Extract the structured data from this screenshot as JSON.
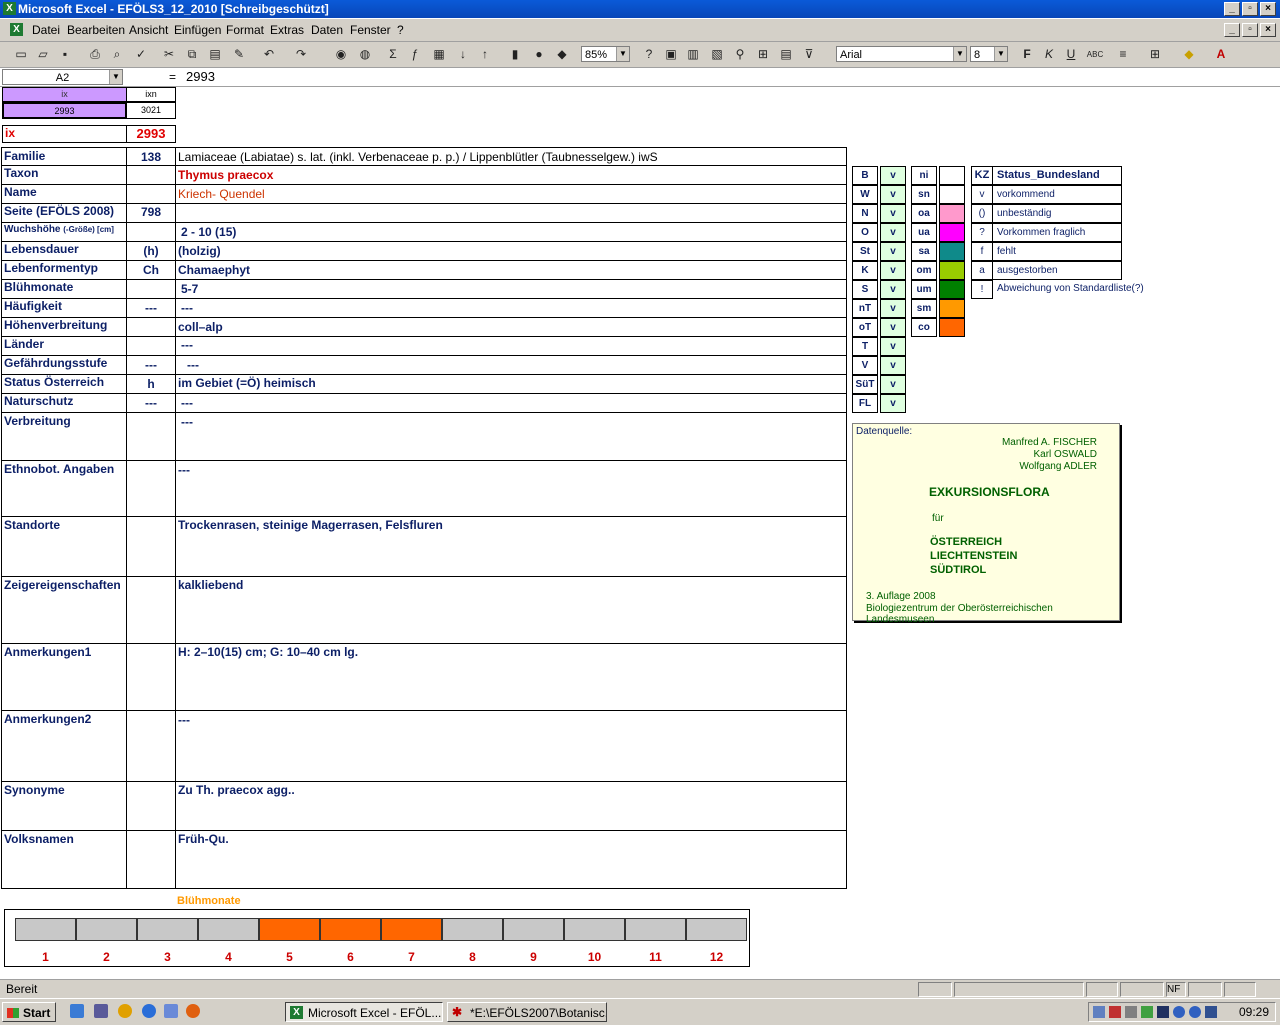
{
  "window": {
    "title": "Microsoft Excel - EFÖLS3_12_2010  [Schreibgeschützt]",
    "app_icon": "X"
  },
  "menu": [
    "Datei",
    "Bearbeiten",
    "Ansicht",
    "Einfügen",
    "Format",
    "Extras",
    "Daten",
    "Fenster",
    "?"
  ],
  "toolbar": {
    "zoom": "85%",
    "font": "Arial",
    "size": "8"
  },
  "formula_bar": {
    "name_box": "A2",
    "equals": "=",
    "content": "2993"
  },
  "top_index": {
    "h1": "ix",
    "h2": "ixn",
    "v1": "2993",
    "v2": "3021",
    "ix_label": "ix",
    "ix_value": "2993"
  },
  "record": {
    "rows": [
      {
        "label": "Familie",
        "code": "138",
        "value": "Lamiaceae (Labiatae) s. lat. (inkl. Verbenaceae p. p.)  /  Lippenblütler (Taubnesselgew.) iwS"
      },
      {
        "label": "Taxon",
        "code": "",
        "value": "Thymus praecox"
      },
      {
        "label": "Name",
        "code": "",
        "value": "Kriech- Quendel"
      },
      {
        "label": "Seite (EFÖLS 2008)",
        "code": "798",
        "value": ""
      },
      {
        "label": "Wuchshöhe",
        "label_small": "(-Größe) [cm]",
        "code": "",
        "value": "2 - 10 (15)"
      },
      {
        "label": "Lebensdauer",
        "code": "(h)",
        "value": "(holzig)"
      },
      {
        "label": "Lebenformentyp",
        "code": "Ch",
        "value": "Chamaephyt"
      },
      {
        "label": "Blühmonate",
        "code": "",
        "value": "5-7"
      },
      {
        "label": "Häufigkeit",
        "code": "---",
        "value": "---"
      },
      {
        "label": "Höhenverbreitung",
        "code": "",
        "value": "coll–alp"
      },
      {
        "label": "Länder",
        "code": "",
        "value": "---"
      },
      {
        "label": "Gefährdungsstufe",
        "code": "---",
        "value": "---"
      },
      {
        "label": "Status Österreich",
        "code": "h",
        "value": "im Gebiet (=Ö) heimisch"
      },
      {
        "label": "Naturschutz",
        "code": "---",
        "value": "---"
      }
    ],
    "big_rows": [
      {
        "label": "Verbreitung",
        "value": "---"
      },
      {
        "label": "Ethnobot. Angaben",
        "value": "---"
      },
      {
        "label": "Standorte",
        "value": "Trockenrasen, steinige Magerrasen, Felsfluren"
      },
      {
        "label": "Zeigereigenschaften",
        "value": "kalkliebend"
      },
      {
        "label": "Anmerkungen1",
        "value": "H: 2–10(15) cm; G: 10–40 cm lg."
      },
      {
        "label": "Anmerkungen2",
        "value": "---"
      },
      {
        "label": "Synonyme",
        "value": "Zu Th. praecox agg.."
      },
      {
        "label": "Volksnamen",
        "value": "Früh-Qu."
      }
    ]
  },
  "bundeslaender": [
    {
      "code": "B",
      "status": "v"
    },
    {
      "code": "W",
      "status": "v"
    },
    {
      "code": "N",
      "status": "v"
    },
    {
      "code": "O",
      "status": "v"
    },
    {
      "code": "St",
      "status": "v"
    },
    {
      "code": "K",
      "status": "v"
    },
    {
      "code": "S",
      "status": "v"
    },
    {
      "code": "nT",
      "status": "v"
    },
    {
      "code": "oT",
      "status": "v"
    },
    {
      "code": "T",
      "status": "v"
    },
    {
      "code": "V",
      "status": "v"
    },
    {
      "code": "SüT",
      "status": "v"
    },
    {
      "code": "FL",
      "status": "v"
    }
  ],
  "hoehenstufen": [
    {
      "code": "ni",
      "color": "#ffffff"
    },
    {
      "code": "sn",
      "color": "#ffffff"
    },
    {
      "code": "oa",
      "color": "#ff99cc"
    },
    {
      "code": "ua",
      "color": "#ff00ff"
    },
    {
      "code": "sa",
      "color": "#0f8a8a"
    },
    {
      "code": "om",
      "color": "#99cc00"
    },
    {
      "code": "um",
      "color": "#008000"
    },
    {
      "code": "sm",
      "color": "#ff9900"
    },
    {
      "code": "co",
      "color": "#ff6600"
    }
  ],
  "status_legend": {
    "header_kz": "KZ",
    "header_status": "Status_Bundesland",
    "items": [
      {
        "kz": "v",
        "text": "vorkommend"
      },
      {
        "kz": "()",
        "text": "unbeständig"
      },
      {
        "kz": "?",
        "text": "Vorkommen fraglich"
      },
      {
        "kz": "f",
        "text": "fehlt"
      },
      {
        "kz": "a",
        "text": "ausgestorben"
      },
      {
        "kz": "!",
        "text": "Abweichung von Standardliste(?)"
      }
    ]
  },
  "source": {
    "label": "Datenquelle:",
    "authors": [
      "Manfred A. FISCHER",
      "Karl OSWALD",
      "Wolfgang ADLER"
    ],
    "title": "EXKURSIONSFLORA",
    "fuer": "für",
    "regions": [
      "ÖSTERREICH",
      "LIECHTENSTEIN",
      "SÜDTIROL"
    ],
    "edition": "3. Auflage 2008",
    "publisher": "Biologiezentrum der Oberösterreichischen Landesmuseen"
  },
  "bloom_chart": {
    "title": "Blühmonate",
    "months": [
      "1",
      "2",
      "3",
      "4",
      "5",
      "6",
      "7",
      "8",
      "9",
      "10",
      "11",
      "12"
    ],
    "active": [
      false,
      false,
      false,
      false,
      true,
      true,
      true,
      false,
      false,
      false,
      false,
      false
    ],
    "active_color": "#ff6600",
    "inactive_color": "#c8c8c8"
  },
  "statusbar": {
    "text": "Bereit",
    "nf": "NF"
  },
  "taskbar": {
    "start": "Start",
    "tasks": [
      "Microsoft Excel - EFÖL...",
      "*E:\\EFÖLS2007\\Botanisc..."
    ],
    "clock": "09:29"
  }
}
